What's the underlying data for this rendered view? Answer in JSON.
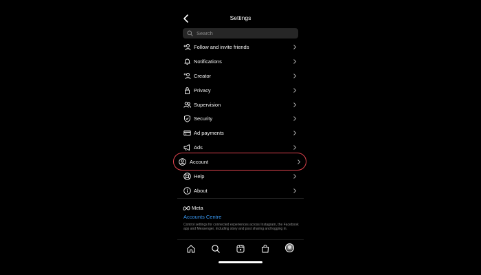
{
  "header": {
    "title": "Settings"
  },
  "search": {
    "placeholder": "Search"
  },
  "menu": {
    "items": [
      {
        "label": "Follow and invite friends",
        "icon": "add-user-icon"
      },
      {
        "label": "Notifications",
        "icon": "bell-icon"
      },
      {
        "label": "Creator",
        "icon": "creator-icon"
      },
      {
        "label": "Privacy",
        "icon": "lock-icon"
      },
      {
        "label": "Supervision",
        "icon": "people-icon"
      },
      {
        "label": "Security",
        "icon": "shield-check-icon"
      },
      {
        "label": "Ad payments",
        "icon": "card-icon"
      },
      {
        "label": "Ads",
        "icon": "megaphone-icon"
      },
      {
        "label": "Account",
        "icon": "account-circle-icon"
      },
      {
        "label": "Help",
        "icon": "lifebuoy-icon"
      },
      {
        "label": "About",
        "icon": "info-icon"
      }
    ]
  },
  "meta": {
    "logo_text": "Meta",
    "accounts_centre": "Accounts Centre",
    "description": "Control settings for connected experiences across Instagram, the Facebook app and Messenger, including story and post sharing and logging in."
  },
  "nav": [
    "home-icon",
    "search-icon",
    "reels-icon",
    "shop-icon",
    "profile-avatar"
  ],
  "colors": {
    "background": "#000000",
    "highlight_ring": "#e0434e",
    "link": "#3897f0"
  }
}
